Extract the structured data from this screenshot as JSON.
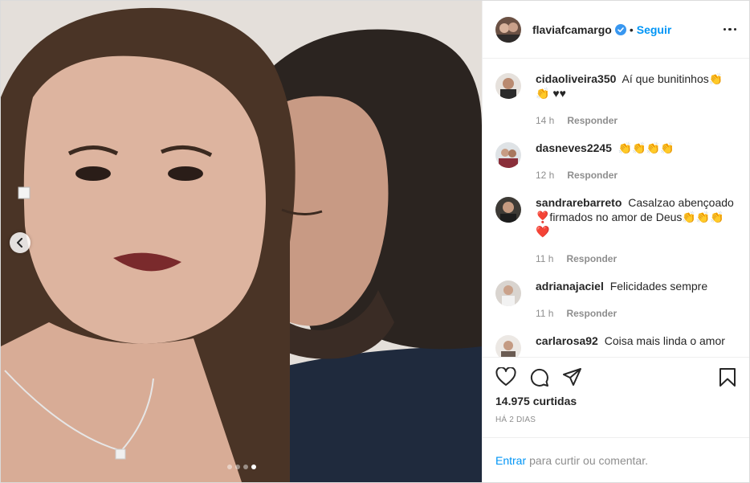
{
  "post": {
    "author": "flaviafcamargo",
    "separator": "•",
    "follow_label": "Seguir",
    "likes": "14.975 curtidas",
    "time_ago": "HÁ 2 DIAS",
    "carousel": {
      "count": 4,
      "active": 3
    }
  },
  "comments": [
    {
      "user": "cidaoliveira350",
      "text": "Aí que bunitinhos👏👏 ♥♥",
      "time": "14 h",
      "reply": "Responder"
    },
    {
      "user": "dasneves2245",
      "text": "👏👏👏👏",
      "time": "12 h",
      "reply": "Responder"
    },
    {
      "user": "sandrarebarreto",
      "text": "Casalzao abençoado ❣️firmados no amor de Deus👏👏👏❤️",
      "time": "11 h",
      "reply": "Responder"
    },
    {
      "user": "adrianajaciel",
      "text": "Felicidades sempre",
      "time": "11 h",
      "reply": "Responder"
    },
    {
      "user": "carlarosa92",
      "text": "Coisa mais linda o amor",
      "time": "",
      "reply": ""
    }
  ],
  "login": {
    "link": "Entrar",
    "rest": "para curtir ou comentar."
  },
  "colors": {
    "link_blue": "#0095f6",
    "muted": "#8e8e8e",
    "text": "#262626",
    "verified": "#3897f0"
  },
  "icons": [
    "chevron-left-icon",
    "more-options-icon",
    "verified-badge-icon",
    "heart-icon",
    "comment-icon",
    "share-icon",
    "bookmark-icon"
  ]
}
